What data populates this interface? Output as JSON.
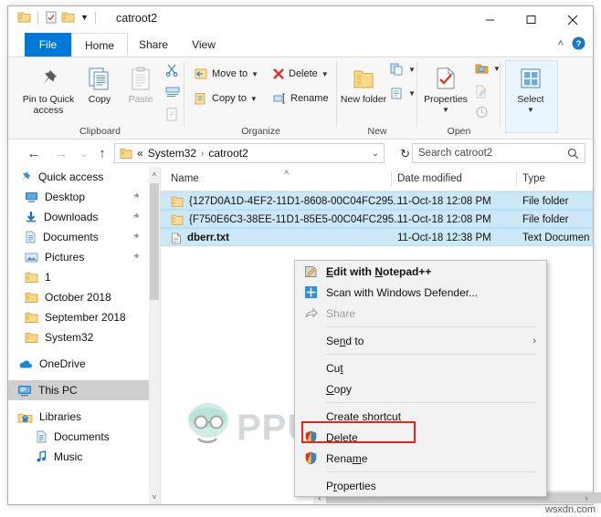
{
  "window": {
    "title": "catroot2",
    "minimize": "─",
    "maximize": "☐",
    "close": "✕",
    "qat": [
      "folder-icon",
      "properties-icon",
      "new-folder-icon",
      "customize-dropdown"
    ]
  },
  "ribbon_tabs": [
    {
      "label": "File",
      "active": false,
      "accent": true
    },
    {
      "label": "Home",
      "active": true
    },
    {
      "label": "Share",
      "active": false
    },
    {
      "label": "View",
      "active": false
    }
  ],
  "ribbon_right": {
    "collapse": "˄",
    "help": "?"
  },
  "ribbon": {
    "groups": [
      {
        "label": "Clipboard",
        "big_buttons": [
          {
            "label": "Pin to Quick access",
            "icon": "pin-icon"
          },
          {
            "label": "Copy",
            "icon": "copy-icon"
          },
          {
            "label": "Paste",
            "icon": "paste-icon",
            "disabled": true
          }
        ],
        "small_buttons": [
          {
            "label": "Cut",
            "icon": "scissors-icon"
          },
          {
            "label": "Copy path",
            "icon": "copy-path-icon"
          },
          {
            "label": "Paste shortcut",
            "icon": "paste-shortcut-icon"
          }
        ]
      },
      {
        "label": "Organize",
        "small_buttons": [
          {
            "label": "Move to",
            "icon": "move-to-icon",
            "caret": true
          },
          {
            "label": "Copy to",
            "icon": "copy-to-icon",
            "caret": true
          },
          {
            "label": "Delete",
            "icon": "delete-x-icon",
            "caret": true
          },
          {
            "label": "Rename",
            "icon": "rename-icon"
          }
        ]
      },
      {
        "label": "New",
        "big_buttons": [
          {
            "label": "New folder",
            "icon": "new-folder-icon"
          }
        ],
        "small_buttons": [
          {
            "label": "New item",
            "icon": "new-item-icon",
            "caret": true
          },
          {
            "label": "Easy access",
            "icon": "easy-access-icon",
            "caret": true
          }
        ]
      },
      {
        "label": "Open",
        "big_buttons": [
          {
            "label": "Properties",
            "icon": "properties-icon",
            "caret": true
          }
        ],
        "small_buttons": [
          {
            "label": "Open",
            "icon": "open-icon",
            "caret": true
          },
          {
            "label": "Edit",
            "icon": "edit-icon",
            "disabled": true
          },
          {
            "label": "History",
            "icon": "history-icon",
            "disabled": true
          }
        ]
      },
      {
        "label": "",
        "big_buttons": [
          {
            "label": "Select",
            "icon": "select-icon",
            "caret": true
          }
        ]
      }
    ]
  },
  "address": {
    "back": "←",
    "forward": "→",
    "recent": "⌄",
    "up": "↑",
    "crumbs": [
      "«",
      "System32",
      "catroot2"
    ],
    "crumb_sep": "›",
    "dropdown": "⌄",
    "refresh": "↻"
  },
  "search": {
    "placeholder": "Search catroot2",
    "icon": "search-icon"
  },
  "nav_pane": {
    "items": [
      {
        "label": "Quick access",
        "icon": "star-pin-icon",
        "root": true
      },
      {
        "label": "Desktop",
        "icon": "desktop-icon",
        "pinned": true
      },
      {
        "label": "Downloads",
        "icon": "download-icon",
        "pinned": true
      },
      {
        "label": "Documents",
        "icon": "documents-icon",
        "pinned": true
      },
      {
        "label": "Pictures",
        "icon": "pictures-icon",
        "pinned": true
      },
      {
        "label": "1",
        "icon": "folder-icon"
      },
      {
        "label": "October 2018",
        "icon": "folder-icon"
      },
      {
        "label": "September 2018",
        "icon": "folder-icon"
      },
      {
        "label": "System32",
        "icon": "folder-icon"
      },
      {
        "label": "OneDrive",
        "icon": "onedrive-icon",
        "root": true,
        "spacer": true
      },
      {
        "label": "This PC",
        "icon": "thispc-icon",
        "root": true,
        "selected": true,
        "spacer": true
      },
      {
        "label": "Libraries",
        "icon": "libraries-icon",
        "root": true,
        "spacer": true
      },
      {
        "label": "Documents",
        "icon": "documents-icon",
        "indent": true
      },
      {
        "label": "Music",
        "icon": "music-icon",
        "indent": true
      }
    ],
    "scroll_up": "˄",
    "scroll_down": "˅"
  },
  "file_list": {
    "columns": [
      {
        "label": "Name",
        "sorted": true,
        "sort_glyph": "˄"
      },
      {
        "label": "Date modified"
      },
      {
        "label": "Type"
      }
    ],
    "rows": [
      {
        "name": "{127D0A1D-4EF2-11D1-8608-00C04FC295...",
        "date": "11-Oct-18 12:08 PM",
        "type": "File folder",
        "icon": "folder-icon",
        "selected": true
      },
      {
        "name": "{F750E6C3-38EE-11D1-85E5-00C04FC295...",
        "date": "11-Oct-18 12:08 PM",
        "type": "File folder",
        "icon": "folder-icon",
        "selected": true
      },
      {
        "name": "dberr.txt",
        "date": "11-Oct-18 12:38 PM",
        "type": "Text Documen",
        "icon": "text-file-icon",
        "selected": true
      }
    ],
    "hscroll": {
      "left": "‹",
      "right": "›"
    }
  },
  "context_menu": {
    "items": [
      {
        "label": "Edit with Notepad++",
        "icon": "notepadpp-icon",
        "bold": true,
        "accel": "E"
      },
      {
        "label": "Scan with Windows Defender...",
        "icon": "defender-icon"
      },
      {
        "label": "Share",
        "icon": "share-icon",
        "disabled": true
      },
      {
        "separator": true
      },
      {
        "label": "Send to",
        "icon": null,
        "submenu": true,
        "arrow": "›",
        "accel": "n"
      },
      {
        "separator": true
      },
      {
        "label": "Cut",
        "icon": null,
        "accel": "t"
      },
      {
        "label": "Copy",
        "icon": null,
        "accel": "C"
      },
      {
        "separator": true
      },
      {
        "label": "Create shortcut",
        "icon": null,
        "accel": "s"
      },
      {
        "label": "Delete",
        "icon": "shield-icon",
        "accel": "D",
        "highlighted": true
      },
      {
        "label": "Rename",
        "icon": "shield-icon",
        "accel": "m"
      },
      {
        "separator": true
      },
      {
        "label": "Properties",
        "icon": null,
        "accel": "r"
      }
    ],
    "highlight_color": "#e8231b"
  },
  "watermarks": {
    "appuals": "PPUALS",
    "wsxdn": "wsxdn.com"
  }
}
